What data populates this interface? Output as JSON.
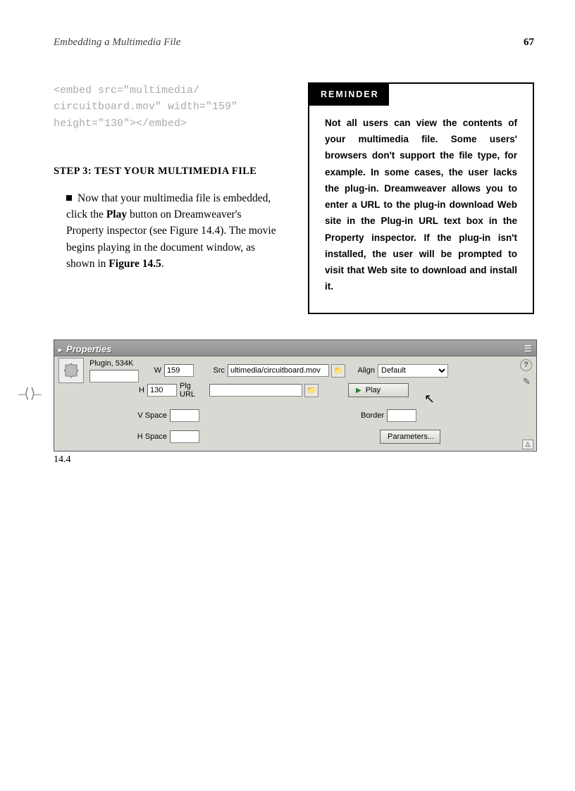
{
  "header": {
    "running_title": "Embedding a Multimedia File",
    "page_number": "67"
  },
  "code": "<embed src=\"multimedia/\ncircuitboard.mov\" width=\"159\"\nheight=\"130\"></embed>",
  "step": {
    "heading": "STEP 3: TEST YOUR MULTIMEDIA FILE",
    "para_before": "Now that your multimedia file is embedded, click the ",
    "bold1": "Play",
    "para_mid": " button on Dreamweaver's Property inspector (see Figure 14.4). The movie begins playing in the document window, as shown in ",
    "bold2": "Figure 14.5",
    "para_after": "."
  },
  "reminder": {
    "label": "REMINDER",
    "body": "Not all users can view the contents of your multimedia file. Some users' browsers don't support the file type, for example. In some cases, the user lacks the plug-in. Dreamweaver allows you to enter a URL to the plug-in download Web site in the Plug-in URL text box in the Property inspector. If the plug-in isn't installed, the user will be prompted to visit that Web site to download and install it."
  },
  "panel": {
    "title": "Properties",
    "plugin_label": "Plugin, 534K",
    "w_label": "W",
    "w_value": "159",
    "h_label": "H",
    "h_value": "130",
    "src_label": "Src",
    "src_value": "ultimedia/circuitboard.mov",
    "plgurl_label": "Plg URL",
    "plgurl_value": "",
    "align_label": "Align",
    "align_value": "Default",
    "play_label": "Play",
    "vspace_label": "V Space",
    "vspace_value": "",
    "hspace_label": "H Space",
    "hspace_value": "",
    "border_label": "Border",
    "border_value": "",
    "parameters_label": "Parameters...",
    "name_value": ""
  },
  "figure_caption": "14.4"
}
